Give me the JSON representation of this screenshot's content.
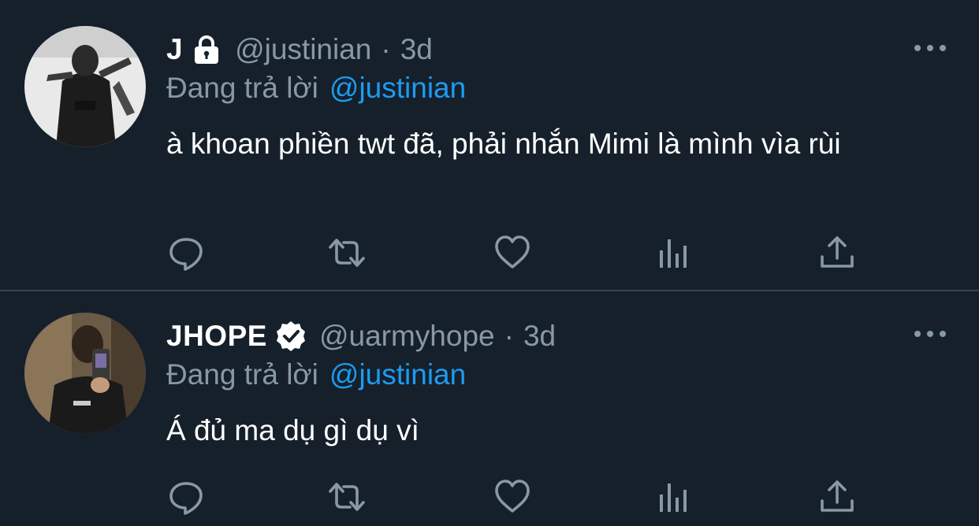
{
  "tweets": [
    {
      "display_name": "J",
      "badge": "lock-icon",
      "handle": "@justinian",
      "separator": "·",
      "time": "3d",
      "reply_prefix": "Đang trả lời",
      "reply_to": "@justinian",
      "text": "à khoan phiền twt đã, phải nhắn Mimi là mình vìa rùi",
      "actions": [
        "reply-icon",
        "retweet-icon",
        "like-icon",
        "analytics-icon",
        "share-icon"
      ]
    },
    {
      "display_name": "JHOPE",
      "badge": "verified-icon",
      "handle": "@uarmyhope",
      "separator": "·",
      "time": "3d",
      "reply_prefix": "Đang trả lời",
      "reply_to": "@justinian",
      "text": "Á đủ ma dụ gì dụ vì",
      "actions": [
        "reply-icon",
        "retweet-icon",
        "like-icon",
        "analytics-icon",
        "share-icon"
      ]
    }
  ],
  "colors": {
    "background": "#15202b",
    "divider": "#38444d",
    "secondary_text": "#8899a6",
    "link": "#1d9bf0",
    "primary_text": "#ffffff"
  }
}
